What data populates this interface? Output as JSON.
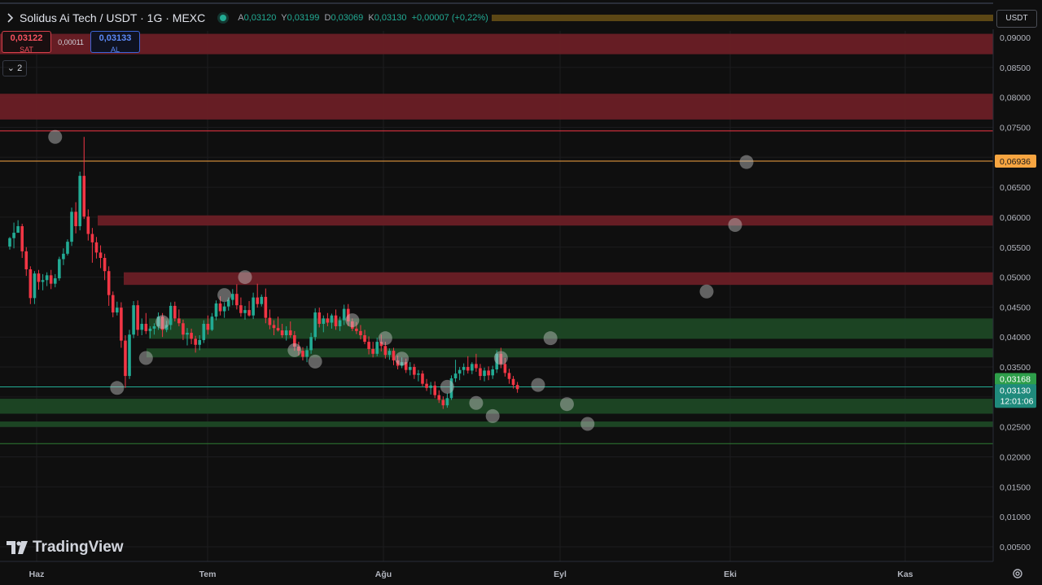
{
  "header": {
    "symbol_title": "Solidus Ai Tech / USDT · 1G · MEXC",
    "ohlc": [
      {
        "k": "A",
        "v": "0,03120"
      },
      {
        "k": "Y",
        "v": "0,03199"
      },
      {
        "k": "D",
        "v": "0,03069"
      },
      {
        "k": "K",
        "v": "0,03130"
      }
    ],
    "change": "+0,00007 (+0,22%)"
  },
  "trade": {
    "sell_price": "0,03122",
    "sell_label": "SAT",
    "spread": "0,00011",
    "buy_price": "0,03133",
    "buy_label": "AL"
  },
  "collapse_label": "2",
  "currency": "USDT",
  "brand": "TradingView",
  "colors": {
    "background": "#0f0f0f",
    "up": "#22ab94",
    "down": "#f23645",
    "resistance_zone": "#6b1f26",
    "support_zone": "#1e4a26",
    "orange_line": "#f7a541"
  },
  "chart_data": {
    "type": "candlestick",
    "x_tick_labels": [
      "Haz",
      "Tem",
      "Ağu",
      "Eyl",
      "Eki",
      "Kas"
    ],
    "y_tick_labels": [
      "0,09000",
      "0,08500",
      "0,08000",
      "0,07500",
      "0,07000",
      "0,06500",
      "0,06000",
      "0,05500",
      "0,05000",
      "0,04500",
      "0,04000",
      "0,03500",
      "0,03000",
      "0,02500",
      "0,02000",
      "0,01500",
      "0,01000",
      "0,00500"
    ],
    "y_ticks": [
      0.09,
      0.085,
      0.08,
      0.075,
      0.07,
      0.065,
      0.06,
      0.055,
      0.05,
      0.045,
      0.04,
      0.035,
      0.03,
      0.025,
      0.02,
      0.015,
      0.01,
      0.005
    ],
    "ylim": [
      0.0005,
      0.0925
    ],
    "price_labels": [
      {
        "value": 0.06936,
        "text": "0,06936",
        "style": "orange"
      },
      {
        "value": 0.03168,
        "text": "0,03168",
        "style": "green"
      },
      {
        "value": 0.0313,
        "text": "0,03130",
        "sub": "12:01:06",
        "style": "teal"
      }
    ],
    "horizontal_lines": [
      {
        "value": 0.0744,
        "color": "#f23645"
      },
      {
        "value": 0.06936,
        "color": "#f7a541"
      },
      {
        "value": 0.03168,
        "color": "#22ab94"
      },
      {
        "value": 0.0222,
        "color": "#2e7d32"
      }
    ],
    "zones": [
      {
        "from": 0.0872,
        "to": 0.0906,
        "kind": "resistance"
      },
      {
        "from": 0.0763,
        "to": 0.0806,
        "kind": "resistance"
      },
      {
        "from": 0.0586,
        "to": 0.0603,
        "kind": "resistance"
      },
      {
        "from": 0.0487,
        "to": 0.0508,
        "kind": "resistance"
      },
      {
        "from": 0.0397,
        "to": 0.0431,
        "kind": "support"
      },
      {
        "from": 0.0366,
        "to": 0.0381,
        "kind": "support"
      },
      {
        "from": 0.0272,
        "to": 0.0297,
        "kind": "support"
      },
      {
        "from": 0.025,
        "to": 0.0259,
        "kind": "support"
      }
    ],
    "markers": [
      [
        11,
        0.0734
      ],
      [
        26,
        0.0315
      ],
      [
        33,
        0.0365
      ],
      [
        37,
        0.0425
      ],
      [
        52,
        0.047
      ],
      [
        57,
        0.05
      ],
      [
        69,
        0.0378
      ],
      [
        74,
        0.0359
      ],
      [
        83,
        0.0428
      ],
      [
        91,
        0.0398
      ],
      [
        95,
        0.0364
      ],
      [
        106,
        0.0317
      ],
      [
        113,
        0.029
      ],
      [
        117,
        0.0268
      ],
      [
        119,
        0.0365
      ],
      [
        128,
        0.032
      ],
      [
        131,
        0.0398
      ],
      [
        135,
        0.0288
      ],
      [
        140,
        0.0255
      ],
      [
        144,
        0.0476
      ],
      [
        145,
        0.0587
      ],
      [
        146,
        0.0692
      ]
    ],
    "candles": [
      [
        0.0551,
        0.0567,
        0.0546,
        0.0565
      ],
      [
        0.0565,
        0.0591,
        0.0548,
        0.0574
      ],
      [
        0.0574,
        0.0595,
        0.0578,
        0.0585
      ],
      [
        0.0585,
        0.0589,
        0.0532,
        0.0543
      ],
      [
        0.0543,
        0.055,
        0.0502,
        0.0513
      ],
      [
        0.0513,
        0.0518,
        0.0455,
        0.0465
      ],
      [
        0.0465,
        0.051,
        0.0455,
        0.0506
      ],
      [
        0.0506,
        0.0512,
        0.0479,
        0.0492
      ],
      [
        0.0492,
        0.0505,
        0.0478,
        0.0495
      ],
      [
        0.0495,
        0.0508,
        0.0485,
        0.0503
      ],
      [
        0.0503,
        0.0512,
        0.048,
        0.0489
      ],
      [
        0.0489,
        0.0505,
        0.0483,
        0.0498
      ],
      [
        0.0498,
        0.0534,
        0.0494,
        0.053
      ],
      [
        0.053,
        0.0548,
        0.052,
        0.0539
      ],
      [
        0.0539,
        0.0563,
        0.0536,
        0.0559
      ],
      [
        0.0559,
        0.0616,
        0.0552,
        0.0609
      ],
      [
        0.0609,
        0.0625,
        0.0573,
        0.0585
      ],
      [
        0.0585,
        0.0676,
        0.0578,
        0.0669
      ],
      [
        0.0669,
        0.0734,
        0.0597,
        0.0601
      ],
      [
        0.0601,
        0.0613,
        0.0561,
        0.0572
      ],
      [
        0.0572,
        0.0582,
        0.0524,
        0.0558
      ],
      [
        0.0558,
        0.0567,
        0.0531,
        0.0541
      ],
      [
        0.0541,
        0.0553,
        0.0515,
        0.0532
      ],
      [
        0.0532,
        0.0539,
        0.0495,
        0.051
      ],
      [
        0.051,
        0.0518,
        0.0452,
        0.047
      ],
      [
        0.047,
        0.0476,
        0.0433,
        0.0441
      ],
      [
        0.0441,
        0.0459,
        0.0436,
        0.0449
      ],
      [
        0.0449,
        0.0458,
        0.0382,
        0.0394
      ],
      [
        0.0394,
        0.0403,
        0.0315,
        0.0335
      ],
      [
        0.0335,
        0.0412,
        0.033,
        0.0404
      ],
      [
        0.0404,
        0.046,
        0.0398,
        0.0453
      ],
      [
        0.0453,
        0.0461,
        0.0402,
        0.0412
      ],
      [
        0.0412,
        0.0431,
        0.0403,
        0.0422
      ],
      [
        0.0422,
        0.044,
        0.0405,
        0.041
      ],
      [
        0.041,
        0.0418,
        0.0398,
        0.0414
      ],
      [
        0.0414,
        0.0423,
        0.0404,
        0.0418
      ],
      [
        0.0418,
        0.0441,
        0.0412,
        0.0434
      ],
      [
        0.0434,
        0.044,
        0.04,
        0.0412
      ],
      [
        0.0412,
        0.0427,
        0.0408,
        0.042
      ],
      [
        0.042,
        0.0458,
        0.0412,
        0.0452
      ],
      [
        0.0452,
        0.0459,
        0.0426,
        0.0431
      ],
      [
        0.0431,
        0.0446,
        0.0418,
        0.0423
      ],
      [
        0.0423,
        0.0429,
        0.0395,
        0.0404
      ],
      [
        0.0404,
        0.0415,
        0.0386,
        0.0407
      ],
      [
        0.0407,
        0.0414,
        0.0388,
        0.0397
      ],
      [
        0.0397,
        0.0402,
        0.0374,
        0.0387
      ],
      [
        0.0387,
        0.0403,
        0.0378,
        0.0395
      ],
      [
        0.0395,
        0.0428,
        0.039,
        0.0422
      ],
      [
        0.0422,
        0.0436,
        0.0404,
        0.0412
      ],
      [
        0.0412,
        0.044,
        0.041,
        0.0434
      ],
      [
        0.0434,
        0.0461,
        0.0428,
        0.0456
      ],
      [
        0.0456,
        0.0468,
        0.0436,
        0.0443
      ],
      [
        0.0443,
        0.0458,
        0.0432,
        0.0451
      ],
      [
        0.0451,
        0.0466,
        0.0444,
        0.0462
      ],
      [
        0.0462,
        0.048,
        0.0453,
        0.0472
      ],
      [
        0.0472,
        0.0488,
        0.0446,
        0.0453
      ],
      [
        0.0453,
        0.0466,
        0.0434,
        0.044
      ],
      [
        0.044,
        0.0452,
        0.0429,
        0.0445
      ],
      [
        0.0445,
        0.046,
        0.0434,
        0.0436
      ],
      [
        0.0436,
        0.0474,
        0.043,
        0.0466
      ],
      [
        0.0466,
        0.0489,
        0.0449,
        0.0455
      ],
      [
        0.0455,
        0.0471,
        0.0451,
        0.0467
      ],
      [
        0.0467,
        0.0481,
        0.0423,
        0.0432
      ],
      [
        0.0432,
        0.0446,
        0.0413,
        0.042
      ],
      [
        0.042,
        0.0428,
        0.0403,
        0.0415
      ],
      [
        0.0415,
        0.0434,
        0.0409,
        0.0411
      ],
      [
        0.0411,
        0.0422,
        0.0399,
        0.0403
      ],
      [
        0.0403,
        0.0418,
        0.0394,
        0.0411
      ],
      [
        0.0411,
        0.0426,
        0.0399,
        0.0403
      ],
      [
        0.0403,
        0.041,
        0.0377,
        0.0384
      ],
      [
        0.0384,
        0.0392,
        0.0369,
        0.0377
      ],
      [
        0.0377,
        0.0383,
        0.0361,
        0.0367
      ],
      [
        0.0367,
        0.0385,
        0.0358,
        0.0378
      ],
      [
        0.0378,
        0.0407,
        0.0372,
        0.04
      ],
      [
        0.04,
        0.0448,
        0.0394,
        0.0441
      ],
      [
        0.0441,
        0.0449,
        0.0416,
        0.0422
      ],
      [
        0.0422,
        0.0436,
        0.0408,
        0.0431
      ],
      [
        0.0431,
        0.044,
        0.0418,
        0.0424
      ],
      [
        0.0424,
        0.0439,
        0.0414,
        0.0436
      ],
      [
        0.0436,
        0.0446,
        0.0412,
        0.0418
      ],
      [
        0.0418,
        0.0434,
        0.041,
        0.0428
      ],
      [
        0.0428,
        0.0454,
        0.042,
        0.0447
      ],
      [
        0.0447,
        0.0455,
        0.0418,
        0.0426
      ],
      [
        0.0426,
        0.0431,
        0.041,
        0.0414
      ],
      [
        0.0414,
        0.0425,
        0.0405,
        0.041
      ],
      [
        0.041,
        0.042,
        0.0396,
        0.0403
      ],
      [
        0.0403,
        0.0412,
        0.0388,
        0.0392
      ],
      [
        0.0392,
        0.0401,
        0.0371,
        0.038
      ],
      [
        0.038,
        0.0392,
        0.0366,
        0.0372
      ],
      [
        0.0372,
        0.0399,
        0.0368,
        0.0392
      ],
      [
        0.0392,
        0.0404,
        0.0376,
        0.0385
      ],
      [
        0.0385,
        0.0392,
        0.0364,
        0.037
      ],
      [
        0.037,
        0.0381,
        0.0362,
        0.0377
      ],
      [
        0.0377,
        0.0382,
        0.0353,
        0.0361
      ],
      [
        0.0361,
        0.0369,
        0.0346,
        0.0352
      ],
      [
        0.0352,
        0.0366,
        0.0348,
        0.0358
      ],
      [
        0.0358,
        0.0364,
        0.034,
        0.0345
      ],
      [
        0.0345,
        0.0358,
        0.0336,
        0.035
      ],
      [
        0.035,
        0.0355,
        0.033,
        0.0337
      ],
      [
        0.0337,
        0.0345,
        0.0326,
        0.0339
      ],
      [
        0.0339,
        0.0344,
        0.0318,
        0.0322
      ],
      [
        0.0322,
        0.033,
        0.031,
        0.0315
      ],
      [
        0.0315,
        0.0325,
        0.0304,
        0.0319
      ],
      [
        0.0319,
        0.0326,
        0.0298,
        0.0303
      ],
      [
        0.0303,
        0.0311,
        0.029,
        0.0295
      ],
      [
        0.0295,
        0.0301,
        0.028,
        0.0286
      ],
      [
        0.0286,
        0.0306,
        0.0282,
        0.0298
      ],
      [
        0.0298,
        0.0336,
        0.0295,
        0.0331
      ],
      [
        0.0331,
        0.0362,
        0.0325,
        0.0339
      ],
      [
        0.0339,
        0.035,
        0.0328,
        0.0345
      ],
      [
        0.0345,
        0.0356,
        0.0336,
        0.035
      ],
      [
        0.035,
        0.0368,
        0.0339,
        0.0344
      ],
      [
        0.0344,
        0.0358,
        0.0338,
        0.0355
      ],
      [
        0.0355,
        0.0372,
        0.0342,
        0.0348
      ],
      [
        0.0348,
        0.0355,
        0.0328,
        0.0335
      ],
      [
        0.0335,
        0.0349,
        0.0326,
        0.0344
      ],
      [
        0.0344,
        0.0351,
        0.0328,
        0.0336
      ],
      [
        0.0336,
        0.0352,
        0.033,
        0.0346
      ],
      [
        0.0346,
        0.0378,
        0.034,
        0.0372
      ],
      [
        0.0372,
        0.0382,
        0.0348,
        0.0355
      ],
      [
        0.0355,
        0.0365,
        0.0334,
        0.034
      ],
      [
        0.034,
        0.0347,
        0.0322,
        0.033
      ],
      [
        0.033,
        0.0335,
        0.0314,
        0.032
      ],
      [
        0.032,
        0.0325,
        0.0307,
        0.0313
      ]
    ]
  }
}
